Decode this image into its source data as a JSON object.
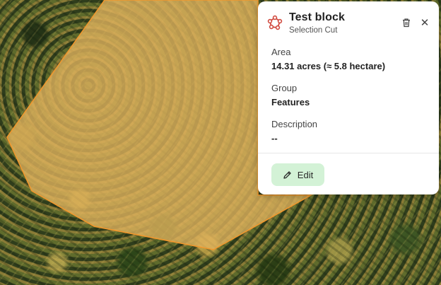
{
  "popup": {
    "title": "Test block",
    "subtitle": "Selection Cut",
    "icons": {
      "shape": "polygon-icon",
      "delete": "trash-icon",
      "close": "close-icon",
      "edit": "pencil-icon"
    },
    "close_glyph": "✕",
    "area_label": "Area",
    "area_value": "14.31 acres (≈ 5.8 hectare)",
    "group_label": "Group",
    "group_value": "Features",
    "description_label": "Description",
    "description_value": "--",
    "edit_label": "Edit"
  },
  "colors": {
    "polygon_fill": "#e2b35e",
    "polygon_stroke": "#f2972c",
    "edit_button_bg": "#d3f2d6",
    "shape_icon": "#d14a3f"
  }
}
